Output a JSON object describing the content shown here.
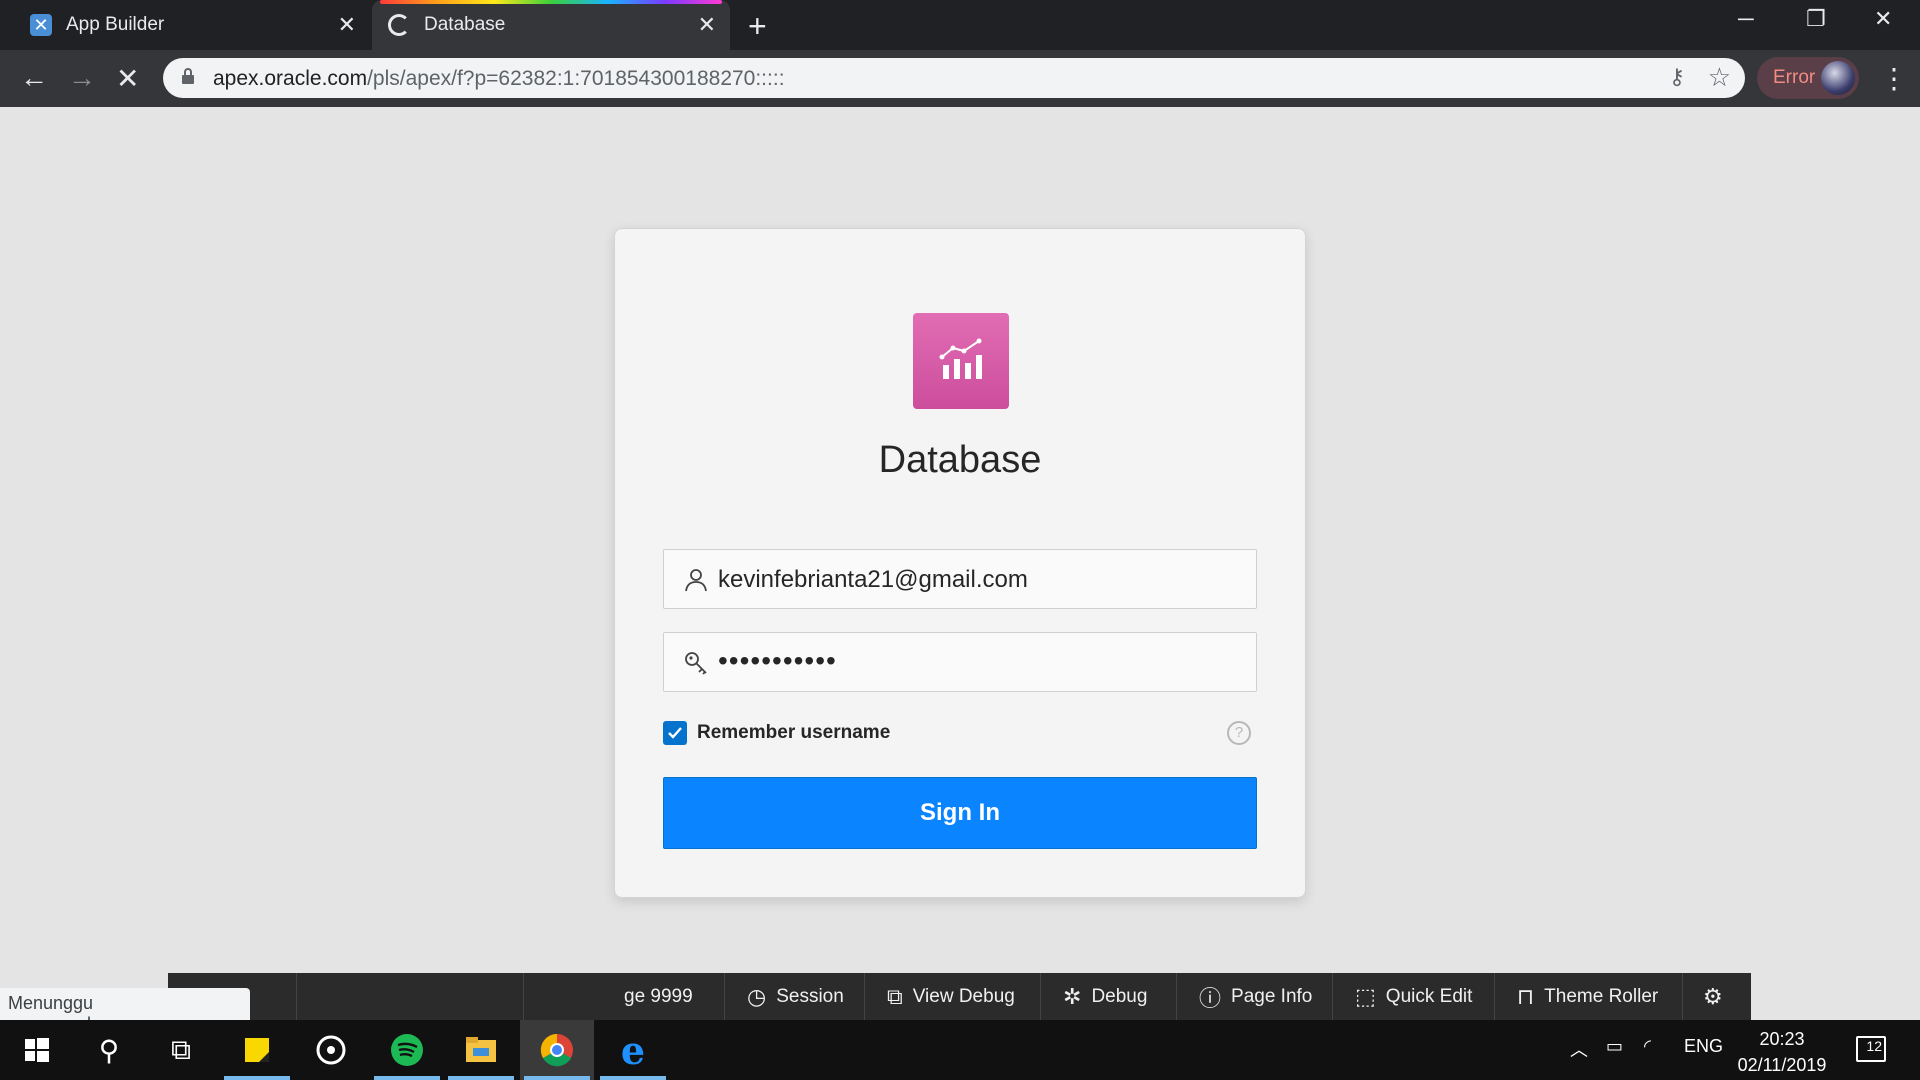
{
  "browser": {
    "tabs": [
      {
        "title": "App Builder",
        "active": false
      },
      {
        "title": "Database",
        "active": true
      }
    ],
    "url_host": "apex.oracle.com",
    "url_path": "/pls/apex/f?p=62382:1:701854300188270:::::",
    "profile_status": "Error",
    "status_text": "Menunggu apex.oracle.com..."
  },
  "login": {
    "app_name": "Database",
    "username": "kevinfebrianta21@gmail.com",
    "password_mask": "•••••••••••",
    "remember_label": "Remember username",
    "remember_checked": true,
    "help_glyph": "?",
    "signin_label": "Sign In",
    "icon_color": "#d85aa8"
  },
  "dev_toolbar": {
    "items": [
      {
        "label": "ge 9999",
        "icon": ""
      },
      {
        "label": "Session",
        "icon": "clock-icon"
      },
      {
        "label": "View Debug",
        "icon": "view-debug-icon"
      },
      {
        "label": "Debug",
        "icon": "bug-icon"
      },
      {
        "label": "Page Info",
        "icon": "info-icon"
      },
      {
        "label": "Quick Edit",
        "icon": "quick-edit-icon"
      },
      {
        "label": "Theme Roller",
        "icon": "paint-roller-icon"
      }
    ]
  },
  "taskbar": {
    "language": "ENG",
    "time": "20:23",
    "date": "02/11/2019",
    "notification_count": "12"
  },
  "colors": {
    "accent_blue": "#0a84ff",
    "checkbox_blue": "#0572ce",
    "error_text": "#f28b82"
  }
}
